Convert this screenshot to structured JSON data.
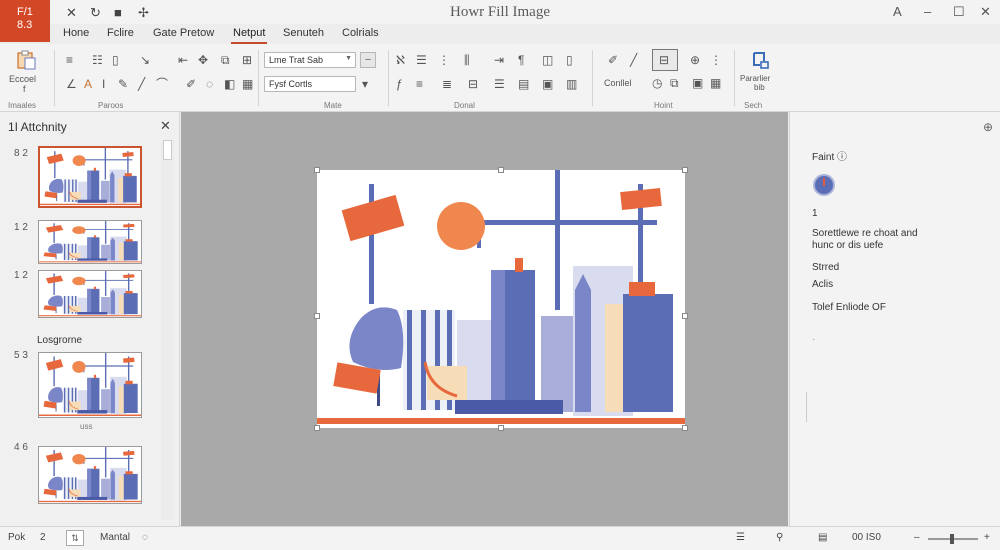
{
  "app": {
    "badge_line1": "F/1",
    "badge_line2": "8.3",
    "badge_color": "#d24726"
  },
  "window": {
    "title": "Howr Fill Image",
    "minimize": "–",
    "maximize": "☐",
    "close": "✕",
    "account": "A"
  },
  "quick_access": [
    "✕",
    "↻",
    "■",
    "✢"
  ],
  "tabs": [
    {
      "label": "Hone",
      "active": false
    },
    {
      "label": "Fclire",
      "active": false
    },
    {
      "label": "Gate Pretow",
      "active": false
    },
    {
      "label": "Netput",
      "active": true
    },
    {
      "label": "Senuteh",
      "active": false
    },
    {
      "label": "Colrials",
      "active": false
    }
  ],
  "ribbon": {
    "paste_label": "Eccoel",
    "paste_sub": "f",
    "group_labels": [
      "Imaales",
      "Paroos",
      "Mate",
      "Donal",
      "Hoint",
      "Sech"
    ],
    "font_combo": "Lme Trat Sab",
    "size_combo": "Fysf Cortls",
    "hoint_button": "Conllel",
    "sech_button_line1": "Pararlier",
    "sech_button_line2": "bib"
  },
  "left_panel": {
    "title": "1I Attchnity",
    "close": "✕",
    "section_label": "Losgrorne",
    "caption": "uss",
    "slides": [
      {
        "number": "8 2",
        "selected": true
      },
      {
        "number": "1 2",
        "selected": false
      },
      {
        "number": "1 2",
        "selected": false
      },
      {
        "number": "5 3",
        "selected": false
      },
      {
        "number": "4 6",
        "selected": false
      }
    ]
  },
  "right_pane": {
    "heading": "Faint",
    "value": "1",
    "description_line1": "Sorettlewe re choat and",
    "description_line2": "hunc or dis uefe",
    "item1": "Strred",
    "item2": "Aclis",
    "item3": "Tolef Enliode OF",
    "pin": "⊕",
    "dot": "·"
  },
  "status_bar": {
    "left": "Pok",
    "slide_ind": "2",
    "page_box": "⇅",
    "mode": "Mantal",
    "zoom": "00 IS0"
  },
  "colors": {
    "accent": "#c54a2b",
    "orange": "#e8683d",
    "navy": "#5b6db4",
    "lavender": "#a8aed8"
  }
}
